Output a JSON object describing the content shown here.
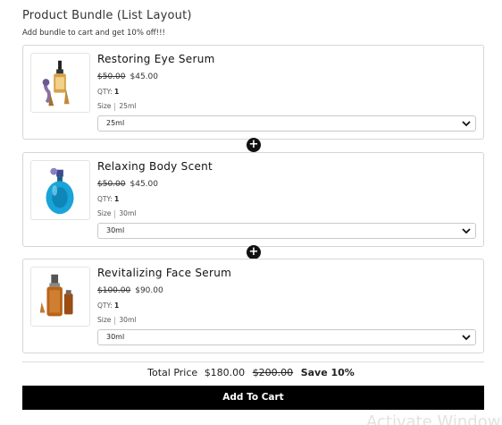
{
  "header": {
    "title": "Product Bundle (List Layout)",
    "subtitle": "Add bundle to cart and get 10% off!!!"
  },
  "products": [
    {
      "name": "Restoring Eye Serum",
      "old_price": "$50.00",
      "price": "$45.00",
      "qty_label": "QTY:",
      "qty": "1",
      "size_label": "Size",
      "size": "25ml",
      "selected_option": "25ml",
      "image_icon": "serum-bottle-image"
    },
    {
      "name": "Relaxing Body Scent",
      "old_price": "$50.00",
      "price": "$45.00",
      "qty_label": "QTY:",
      "qty": "1",
      "size_label": "Size",
      "size": "30ml",
      "selected_option": "30ml",
      "image_icon": "perfume-bottle-image"
    },
    {
      "name": "Revitalizing Face Serum",
      "old_price": "$100.00",
      "price": "$90.00",
      "qty_label": "QTY:",
      "qty": "1",
      "size_label": "Size",
      "size": "30ml",
      "selected_option": "30ml",
      "image_icon": "face-serum-bottle-image"
    }
  ],
  "plus_symbol": "+",
  "summary": {
    "label": "Total Price",
    "total": "$180.00",
    "original": "$200.00",
    "save": "Save 10%"
  },
  "cart_button": "Add To Cart",
  "watermark": "Activate Windows",
  "colors": {
    "button_bg": "#000000",
    "accent_blue": "#1aa3d9",
    "amber": "#b8641a"
  }
}
